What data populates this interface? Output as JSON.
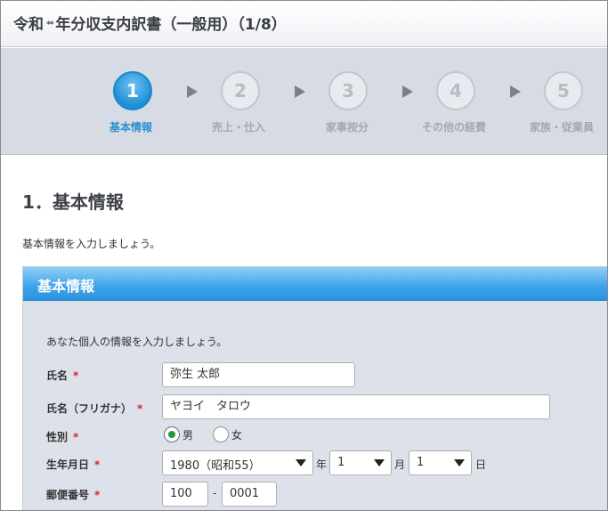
{
  "window": {
    "title_prefix": "令和",
    "title_era": "**",
    "title_main": "年分収支内訳書（一般用）（1/8）"
  },
  "steps": [
    {
      "number": "1",
      "label": "基本情報",
      "active": true
    },
    {
      "number": "2",
      "label": "売上・仕入",
      "active": false
    },
    {
      "number": "3",
      "label": "家事按分",
      "active": false
    },
    {
      "number": "4",
      "label": "その他の経費",
      "active": false
    },
    {
      "number": "5",
      "label": "家族・従業員",
      "active": false
    }
  ],
  "section": {
    "title": "1．基本情報",
    "intro": "基本情報を入力しましょう。"
  },
  "panel": {
    "header": "基本情報",
    "intro": "あなた個人の情報を入力しましょう。",
    "required_mark": "*",
    "fields": {
      "name": {
        "label": "氏名",
        "value": "弥生 太郎"
      },
      "furigana": {
        "label": "氏名（フリガナ）",
        "value": "ヤヨイ　タロウ"
      },
      "gender": {
        "label": "性別",
        "options": [
          "男",
          "女"
        ],
        "selected": "男"
      },
      "birthdate": {
        "label": "生年月日",
        "year": "1980（昭和55）",
        "year_unit": "年",
        "month": "1",
        "month_unit": "月",
        "day": "1",
        "day_unit": "日"
      },
      "postal": {
        "label": "郵便番号",
        "part1": "100",
        "separator": "-",
        "part2": "0001"
      }
    }
  },
  "colors": {
    "accent": "#2c8fd2",
    "required": "#d9232d",
    "radio_selected": "#1e9b3c"
  }
}
